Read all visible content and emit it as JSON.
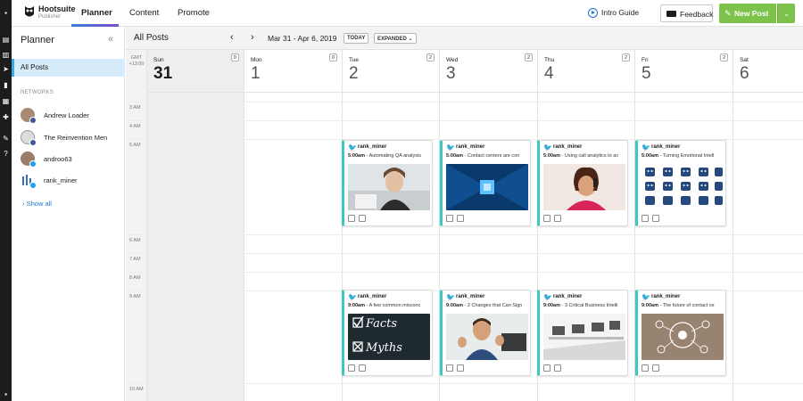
{
  "app": {
    "logo_title": "Hootsuite",
    "logo_subtitle": "Publisher"
  },
  "topnav": {
    "tabs": [
      {
        "label": "Planner",
        "active": true
      },
      {
        "label": "Content",
        "active": false
      },
      {
        "label": "Promote",
        "active": false
      }
    ],
    "intro_guide": "Intro Guide",
    "feedback": "Feedback",
    "new_post": "New Post",
    "accent_color": "#7dc24b"
  },
  "sidebar": {
    "title": "Planner",
    "all_posts": "All Posts",
    "networks_label": "NETWORKS",
    "networks": [
      {
        "name": "Andrew Loader",
        "network": "facebook"
      },
      {
        "name": "The Reinvention Men",
        "network": "facebook"
      },
      {
        "name": "androo63",
        "network": "twitter"
      },
      {
        "name": "rank_miner",
        "network": "twitter"
      }
    ],
    "show_all": "Show all"
  },
  "calendar": {
    "title": "All Posts",
    "range": "Mar 31 - Apr 6, 2019",
    "today_btn": "TODAY",
    "view_btn": "EXPANDED",
    "gmt_label": "GMT",
    "gmt_offset": "+13:00",
    "days": [
      {
        "dow": "Sun",
        "num": "31",
        "count": "0",
        "today": true
      },
      {
        "dow": "Mon",
        "num": "1",
        "count": "0"
      },
      {
        "dow": "Tue",
        "num": "2",
        "count": "2"
      },
      {
        "dow": "Wed",
        "num": "3",
        "count": "2"
      },
      {
        "dow": "Thu",
        "num": "4",
        "count": "2"
      },
      {
        "dow": "Fri",
        "num": "5",
        "count": "2"
      },
      {
        "dow": "Sat",
        "num": "6",
        "count": ""
      }
    ],
    "hours": [
      "3 AM",
      "4 AM",
      "5 AM",
      "6 AM",
      "7 AM",
      "8 AM",
      "9 AM",
      "10 AM"
    ],
    "posts": [
      {
        "day": 2,
        "slot": "5",
        "user": "rank_miner",
        "time": "5:00am",
        "text": "Automating QA analysis",
        "image": "headset-woman"
      },
      {
        "day": 3,
        "slot": "5",
        "user": "rank_miner",
        "time": "5:00am",
        "text": "Contact centers are con",
        "image": "server-room"
      },
      {
        "day": 4,
        "slot": "5",
        "user": "rank_miner",
        "time": "5:00am",
        "text": "Using call analytics to ac",
        "image": "phone-woman"
      },
      {
        "day": 5,
        "slot": "5",
        "user": "rank_miner",
        "time": "5:00am",
        "text": "Turning Emotional Intell",
        "image": "emoji-faces"
      },
      {
        "day": 2,
        "slot": "9",
        "user": "rank_miner",
        "time": "9:00am",
        "text": "A few common misconc",
        "image": "facts-myths",
        "img_text_1": "Facts",
        "img_text_2": "Myths"
      },
      {
        "day": 3,
        "slot": "9",
        "user": "rank_miner",
        "time": "9:00am",
        "text": "2 Changes that Can Sign",
        "image": "thumbs-up-man"
      },
      {
        "day": 4,
        "slot": "9",
        "user": "rank_miner",
        "time": "9:00am",
        "text": "3 Critical Business Intelli",
        "image": "office-desks"
      },
      {
        "day": 5,
        "slot": "9",
        "user": "rank_miner",
        "time": "9:00am",
        "text": "The future of contact ce",
        "image": "digital-network"
      }
    ]
  }
}
